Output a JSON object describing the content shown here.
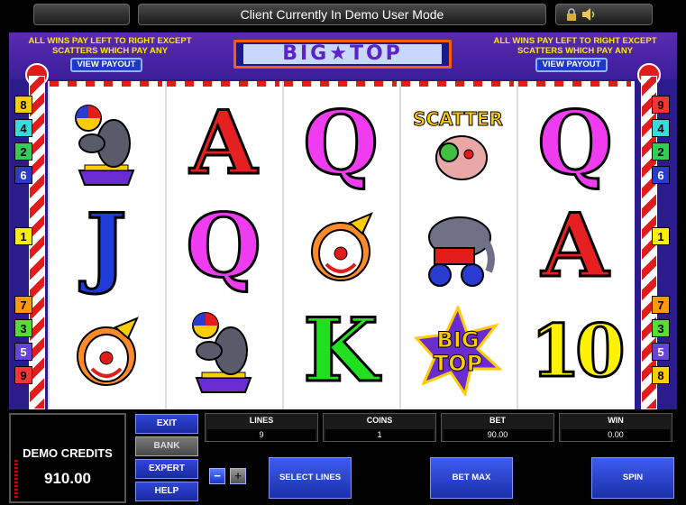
{
  "status_message": "Client Currently In Demo User Mode",
  "title": "BIG★TOP",
  "paytable_note": "ALL WINS PAY LEFT TO RIGHT EXCEPT SCATTERS WHICH PAY ANY",
  "view_payout_label": "VIEW PAYOUT",
  "left_markers": [
    "8",
    "4",
    "2",
    "6",
    "1",
    "7",
    "3",
    "5",
    "9"
  ],
  "right_markers": [
    "9",
    "4",
    "2",
    "6",
    "1",
    "7",
    "3",
    "5",
    "8"
  ],
  "reels": [
    [
      "seal",
      "A",
      "Q",
      "scatter",
      "Q"
    ],
    [
      "J",
      "Q",
      "clown",
      "elephant",
      "A"
    ],
    [
      "clown",
      "seal",
      "K",
      "bigtop",
      "10"
    ]
  ],
  "symbols_text": {
    "scatter": "SCATTER",
    "bigtop_line1": "BIG",
    "bigtop_line2": "TOP"
  },
  "credits": {
    "label": "DEMO CREDITS",
    "value": "910.00"
  },
  "buttons": {
    "exit": "EXIT",
    "bank": "BANK",
    "expert": "EXPERT",
    "help": "HELP",
    "minus": "−",
    "plus": "+",
    "select_lines": "SELECT LINES",
    "bet_max": "BET MAX",
    "spin": "SPIN"
  },
  "stats": {
    "lines_label": "LINES",
    "lines_value": "9",
    "coins_label": "COINS",
    "coins_value": "1",
    "bet_label": "BET",
    "bet_value": "90.00",
    "win_label": "WIN",
    "win_value": "0.00"
  },
  "colors": {
    "accent": "#1f38c8",
    "title": "#5a22c8",
    "stripe": "#e21b1b"
  }
}
